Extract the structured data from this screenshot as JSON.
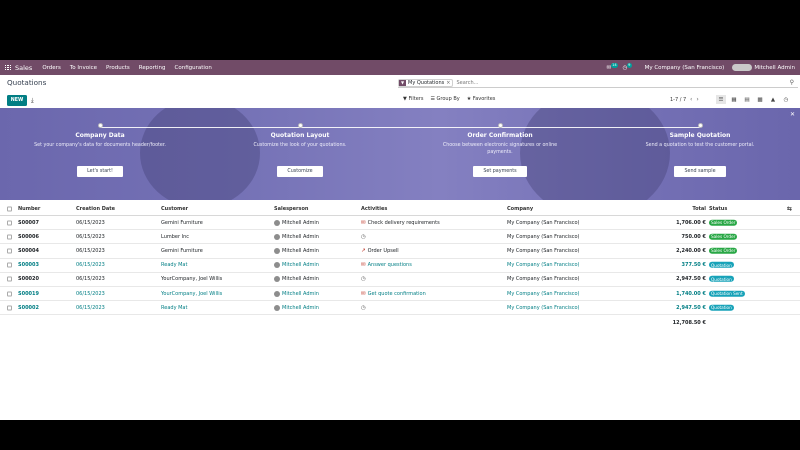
{
  "navbar": {
    "brand": "Sales",
    "menu": [
      "Orders",
      "To Invoice",
      "Products",
      "Reporting",
      "Configuration"
    ],
    "messages_count": "14",
    "activities_count": "9",
    "company": "My Company (San Francisco)",
    "user": "Mitchell Admin"
  },
  "control_panel": {
    "title": "Quotations",
    "search": {
      "facet": "My Quotations",
      "placeholder": "Search..."
    },
    "new_label": "NEW",
    "filters_label": "Filters",
    "groupby_label": "Group By",
    "favorites_label": "Favorites",
    "pager": "1-7 / 7"
  },
  "banner": {
    "steps": [
      {
        "title": "Company Data",
        "desc": "Set your company's data for documents header/footer.",
        "button": "Let's start!"
      },
      {
        "title": "Quotation Layout",
        "desc": "Customize the look of your quotations.",
        "button": "Customize"
      },
      {
        "title": "Order Confirmation",
        "desc": "Choose between electronic signatures or online payments.",
        "button": "Set payments"
      },
      {
        "title": "Sample Quotation",
        "desc": "Send a quotation to test the customer portal.",
        "button": "Send sample"
      }
    ]
  },
  "table": {
    "headers": {
      "number": "Number",
      "date": "Creation Date",
      "customer": "Customer",
      "salesperson": "Salesperson",
      "activities": "Activities",
      "company": "Company",
      "total": "Total",
      "status": "Status"
    },
    "rows": [
      {
        "number": "S00007",
        "date": "06/15/2023",
        "customer": "Gemini Furniture",
        "salesperson": "Mitchell Admin",
        "activity": "Check delivery requirements",
        "activity_icon": "email-icon",
        "company": "My Company (San Francisco)",
        "total": "1,706.00 €",
        "status": "Sales Order",
        "highlight": false
      },
      {
        "number": "S00006",
        "date": "06/15/2023",
        "customer": "Lumber Inc",
        "salesperson": "Mitchell Admin",
        "activity": "",
        "activity_icon": "clock-icon",
        "company": "My Company (San Francisco)",
        "total": "750.00 €",
        "status": "Sales Order",
        "highlight": false
      },
      {
        "number": "S00004",
        "date": "06/15/2023",
        "customer": "Gemini Furniture",
        "salesperson": "Mitchell Admin",
        "activity": "Order Upsell",
        "activity_icon": "chart-icon",
        "company": "My Company (San Francisco)",
        "total": "2,240.00 €",
        "status": "Sales Order",
        "highlight": false
      },
      {
        "number": "S00003",
        "date": "06/15/2023",
        "customer": "Ready Mat",
        "salesperson": "Mitchell Admin",
        "activity": "Answer questions",
        "activity_icon": "email-icon",
        "company": "My Company (San Francisco)",
        "total": "377.50 €",
        "status": "Quotation",
        "highlight": true
      },
      {
        "number": "S00020",
        "date": "06/15/2023",
        "customer": "YourCompany, Joel Willis",
        "salesperson": "Mitchell Admin",
        "activity": "",
        "activity_icon": "clock-icon",
        "company": "My Company (San Francisco)",
        "total": "2,947.50 €",
        "status": "Quotation",
        "highlight": false
      },
      {
        "number": "S00019",
        "date": "06/15/2023",
        "customer": "YourCompany, Joel Willis",
        "salesperson": "Mitchell Admin",
        "activity": "Get quote confirmation",
        "activity_icon": "email-icon",
        "company": "My Company (San Francisco)",
        "total": "1,740.00 €",
        "status": "Quotation Sent",
        "highlight": true
      },
      {
        "number": "S00002",
        "date": "06/15/2023",
        "customer": "Ready Mat",
        "salesperson": "Mitchell Admin",
        "activity": "",
        "activity_icon": "clock-icon",
        "company": "My Company (San Francisco)",
        "total": "2,947.50 €",
        "status": "Quotation",
        "highlight": true
      }
    ],
    "grand_total": "12,708.50 €"
  },
  "colors": {
    "brand": "#714b67",
    "accent": "#017e84",
    "sales_order": "#28a745",
    "quotation": "#17a2b8"
  }
}
